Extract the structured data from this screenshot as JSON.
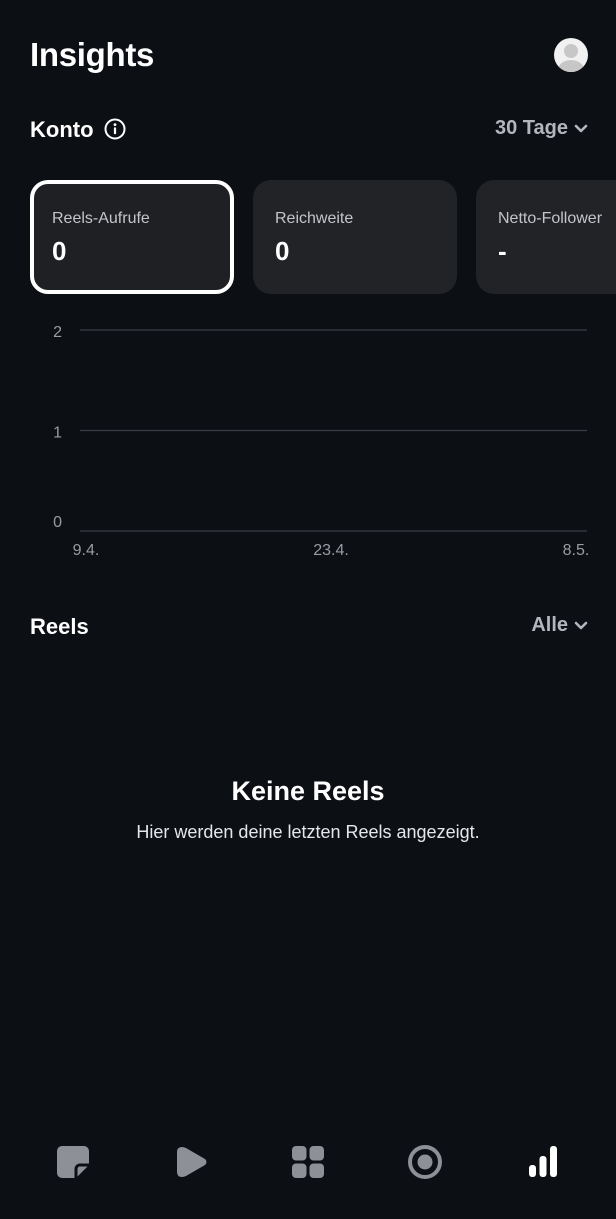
{
  "header": {
    "title": "Insights"
  },
  "account": {
    "label": "Konto",
    "range": "30 Tage"
  },
  "cards": [
    {
      "label": "Reels-Aufrufe",
      "value": "0",
      "selected": true
    },
    {
      "label": "Reichweite",
      "value": "0",
      "selected": false
    },
    {
      "label": "Netto-Follower",
      "value": "-",
      "selected": false
    }
  ],
  "chart_data": {
    "type": "line",
    "x": [
      "9.4.",
      "23.4.",
      "8.5."
    ],
    "y_ticks": [
      "0",
      "1",
      "2"
    ],
    "ylim": [
      0,
      2
    ],
    "series": [],
    "grid": true
  },
  "reels": {
    "label": "Reels",
    "filter": "Alle",
    "empty_title": "Keine Reels",
    "empty_subtitle": "Hier werden deine letzten Reels angezeigt."
  },
  "tabbar": {
    "items": [
      {
        "icon": "posts-icon",
        "active": false
      },
      {
        "icon": "reels-play-icon",
        "active": false
      },
      {
        "icon": "grid-icon",
        "active": false
      },
      {
        "icon": "record-icon",
        "active": false
      },
      {
        "icon": "insights-bars-icon",
        "active": true
      }
    ]
  },
  "colors": {
    "background": "#0c0f14",
    "card": "#222327",
    "muted": "#b3b6bc",
    "grid": "#3a3d44"
  }
}
